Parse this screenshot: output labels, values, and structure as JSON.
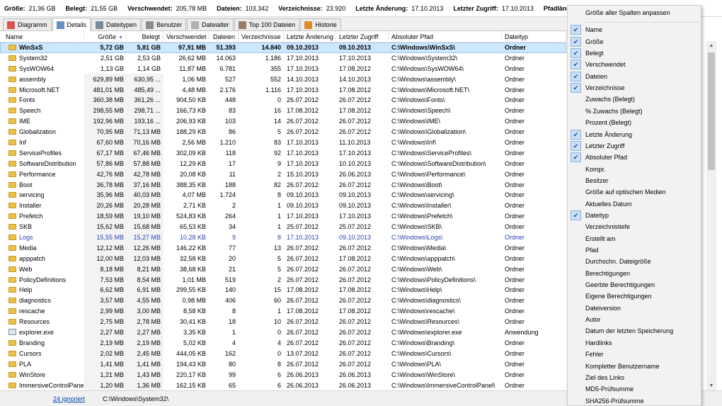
{
  "summary": [
    {
      "label": "Größe:",
      "value": "21,36 GB"
    },
    {
      "label": "Belegt:",
      "value": "21,55 GB"
    },
    {
      "label": "Verschwendet:",
      "value": "205,78 MB"
    },
    {
      "label": "Dateien:",
      "value": "103.342"
    },
    {
      "label": "Verzeichnisse:",
      "value": "23.920"
    },
    {
      "label": "Letzte Änderung:",
      "value": "17.10.2013"
    },
    {
      "label": "Letzter Zugriff:",
      "value": "17.10.2013"
    },
    {
      "label": "Pfadläng",
      "value": ""
    }
  ],
  "tabs": [
    {
      "label": "Diagramm",
      "icon": "chart-icon",
      "color": "#d9534f"
    },
    {
      "label": "Details",
      "icon": "details-icon",
      "color": "#6b8fbf",
      "active": true
    },
    {
      "label": "Dateitypen",
      "icon": "filetypes-icon",
      "color": "#7b8a9a"
    },
    {
      "label": "Benutzer",
      "icon": "users-icon",
      "color": "#8c8c8c"
    },
    {
      "label": "Dateialter",
      "icon": "fileage-icon",
      "color": "#b0b0b0"
    },
    {
      "label": "Top 100 Dateien",
      "icon": "top100-icon",
      "color": "#9a7b6a"
    },
    {
      "label": "Historie",
      "icon": "history-icon",
      "color": "#e08a2e"
    }
  ],
  "columns": [
    "Name",
    "Größe",
    "Belegt",
    "Verschwendet",
    "Dateien",
    "Verzeichnisse",
    "Letzte Änderung",
    "Letzter Zugriff",
    "Absoluter Pfad",
    "Dateityp"
  ],
  "rows": [
    [
      "WinSxS",
      "5,72 GB",
      "5,81 GB",
      "97,91 MB",
      "51.393",
      "14.840",
      "09.10.2013",
      "09.10.2013",
      "C:\\Windows\\WinSxS\\",
      "Ordner"
    ],
    [
      "System32",
      "2,51 GB",
      "2,53 GB",
      "26,62 MB",
      "14.063",
      "1.186",
      "17.10.2013",
      "17.10.2013",
      "C:\\Windows\\System32\\",
      "Ordner"
    ],
    [
      "SysWOW64",
      "1,13 GB",
      "1,14 GB",
      "11,87 MB",
      "6.781",
      "355",
      "17.10.2013",
      "17.08.2012",
      "C:\\Windows\\SysWOW64\\",
      "Ordner"
    ],
    [
      "assembly",
      "629,89 MB",
      "630,95 ...",
      "1,06 MB",
      "527",
      "552",
      "14.10.2013",
      "14.10.2013",
      "C:\\Windows\\assembly\\",
      "Ordner"
    ],
    [
      "Microsoft.NET",
      "481,01 MB",
      "485,49 ...",
      "4,48 MB",
      "2.176",
      "1.116",
      "17.10.2013",
      "17.08.2012",
      "C:\\Windows\\Microsoft.NET\\",
      "Ordner"
    ],
    [
      "Fonts",
      "360,38 MB",
      "361,26 ...",
      "904,50 KB",
      "448",
      "0",
      "26.07.2012",
      "26.07.2012",
      "C:\\Windows\\Fonts\\",
      "Ordner"
    ],
    [
      "Speech",
      "298,55 MB",
      "298,71 ...",
      "166,73 KB",
      "83",
      "16",
      "17.08.2012",
      "17.08.2012",
      "C:\\Windows\\Speech\\",
      "Ordner"
    ],
    [
      "IME",
      "192,96 MB",
      "193,16 ...",
      "206,93 KB",
      "103",
      "14",
      "26.07.2012",
      "26.07.2012",
      "C:\\Windows\\IME\\",
      "Ordner"
    ],
    [
      "Globalization",
      "70,95 MB",
      "71,13 MB",
      "188,29 KB",
      "86",
      "5",
      "26.07.2012",
      "26.07.2012",
      "C:\\Windows\\Globalization\\",
      "Ordner"
    ],
    [
      "Inf",
      "67,60 MB",
      "70,16 MB",
      "2,56 MB",
      "1.210",
      "83",
      "17.10.2013",
      "11.10.2013",
      "C:\\Windows\\Inf\\",
      "Ordner"
    ],
    [
      "ServiceProfiles",
      "67,17 MB",
      "67,46 MB",
      "302,09 KB",
      "118",
      "92",
      "17.10.2013",
      "17.10.2013",
      "C:\\Windows\\ServiceProfiles\\",
      "Ordner"
    ],
    [
      "SoftwareDistribution",
      "57,86 MB",
      "57,88 MB",
      "12,29 KB",
      "17",
      "9",
      "17.10.2013",
      "10.10.2013",
      "C:\\Windows\\SoftwareDistribution\\",
      "Ordner"
    ],
    [
      "Performance",
      "42,76 MB",
      "42,78 MB",
      "20,08 KB",
      "11",
      "2",
      "15.10.2013",
      "26.06.2013",
      "C:\\Windows\\Performance\\",
      "Ordner"
    ],
    [
      "Boot",
      "36,78 MB",
      "37,16 MB",
      "388,35 KB",
      "188",
      "82",
      "26.07.2012",
      "26.07.2012",
      "C:\\Windows\\Boot\\",
      "Ordner"
    ],
    [
      "servicing",
      "35,96 MB",
      "40,03 MB",
      "4,07 MB",
      "1.724",
      "8",
      "09.10.2013",
      "09.10.2013",
      "C:\\Windows\\servicing\\",
      "Ordner"
    ],
    [
      "Installer",
      "20,26 MB",
      "20,28 MB",
      "2,71 KB",
      "2",
      "1",
      "09.10.2013",
      "09.10.2013",
      "C:\\Windows\\Installer\\",
      "Ordner"
    ],
    [
      "Prefetch",
      "18,59 MB",
      "19,10 MB",
      "524,83 KB",
      "264",
      "1",
      "17.10.2013",
      "17.10.2013",
      "C:\\Windows\\Prefetch\\",
      "Ordner"
    ],
    [
      "SKB",
      "15,62 MB",
      "15,68 MB",
      "65,53 KB",
      "34",
      "1",
      "25.07.2012",
      "25.07.2012",
      "C:\\Windows\\SKB\\",
      "Ordner"
    ],
    [
      "Logs",
      "15,55 MB",
      "15,27 MB",
      "10,28 KB",
      "9",
      "8",
      "17.10.2013",
      "09.10.2013",
      "C:\\Windows\\Logs\\",
      "Ordner"
    ],
    [
      "Media",
      "12,12 MB",
      "12,26 MB",
      "146,22 KB",
      "77",
      "13",
      "26.07.2012",
      "26.07.2012",
      "C:\\Windows\\Media\\",
      "Ordner"
    ],
    [
      "apppatch",
      "12,00 MB",
      "12,03 MB",
      "32,58 KB",
      "20",
      "5",
      "26.07.2012",
      "17.08.2012",
      "C:\\Windows\\apppatch\\",
      "Ordner"
    ],
    [
      "Web",
      "8,18 MB",
      "8,21 MB",
      "38,68 KB",
      "21",
      "5",
      "26.07.2012",
      "26.07.2012",
      "C:\\Windows\\Web\\",
      "Ordner"
    ],
    [
      "PolicyDefinitions",
      "7,53 MB",
      "8,54 MB",
      "1,01 MB",
      "519",
      "2",
      "26.07.2012",
      "26.07.2012",
      "C:\\Windows\\PolicyDefinitions\\",
      "Ordner"
    ],
    [
      "Help",
      "6,62 MB",
      "6,91 MB",
      "299,55 KB",
      "140",
      "15",
      "17.08.2012",
      "17.08.2012",
      "C:\\Windows\\Help\\",
      "Ordner"
    ],
    [
      "diagnostics",
      "3,57 MB",
      "4,55 MB",
      "0,98 MB",
      "406",
      "60",
      "26.07.2012",
      "26.07.2012",
      "C:\\Windows\\diagnostics\\",
      "Ordner"
    ],
    [
      "rescache",
      "2,99 MB",
      "3,00 MB",
      "8,58 KB",
      "8",
      "1",
      "17.08.2012",
      "17.08.2012",
      "C:\\Windows\\rescache\\",
      "Ordner"
    ],
    [
      "Resources",
      "2,75 MB",
      "2,78 MB",
      "30,41 KB",
      "18",
      "10",
      "26.07.2012",
      "26.07.2012",
      "C:\\Windows\\Resources\\",
      "Ordner"
    ],
    [
      "explorer.exe",
      "2,27 MB",
      "2,27 MB",
      "3,35 KB",
      "1",
      "0",
      "26.07.2012",
      "26.07.2012",
      "C:\\Windows\\explorer.exe",
      "Anwendung"
    ],
    [
      "Branding",
      "2,19 MB",
      "2,19 MB",
      "5,02 KB",
      "4",
      "4",
      "26.07.2012",
      "26.07.2012",
      "C:\\Windows\\Branding\\",
      "Ordner"
    ],
    [
      "Cursors",
      "2,02 MB",
      "2,45 MB",
      "444,05 KB",
      "162",
      "0",
      "13.07.2012",
      "26.07.2012",
      "C:\\Windows\\Cursors\\",
      "Ordner"
    ],
    [
      "PLA",
      "1,41 MB",
      "1,41 MB",
      "194,43 KB",
      "80",
      "8",
      "26.07.2012",
      "26.07.2012",
      "C:\\Windows\\PLA\\",
      "Ordner"
    ],
    [
      "WinStore",
      "1,21 MB",
      "1,43 MB",
      "220,17 KB",
      "99",
      "6",
      "26.06.2013",
      "26.06.2013",
      "C:\\Windows\\WinStore\\",
      "Ordner"
    ],
    [
      "ImmersiveControlPanel",
      "1,20 MB",
      "1,36 MB",
      "162,15 KB",
      "65",
      "6",
      "26.06.2013",
      "26.06.2013",
      "C:\\Windows\\ImmersiveControlPanel\\",
      "Ordner"
    ]
  ],
  "row_types": [
    "folder",
    "folder",
    "folder",
    "folder",
    "folder",
    "folder",
    "folder",
    "folder",
    "folder",
    "folder",
    "folder",
    "folder",
    "folder",
    "folder",
    "folder",
    "folder",
    "folder",
    "folder",
    "folder",
    "folder",
    "folder",
    "folder",
    "folder",
    "folder",
    "folder",
    "folder",
    "folder",
    "file",
    "folder",
    "folder",
    "folder",
    "folder",
    "folder"
  ],
  "selected_row": 0,
  "highlight_row": 18,
  "status": {
    "ignored_link": "24 ignoriert",
    "path": "C:\\Windows\\System32\\"
  },
  "menu": {
    "items": [
      {
        "label": "Größe aller Spalten anpassen",
        "checked": false
      },
      {
        "label": "Name",
        "checked": true
      },
      {
        "label": "Größe",
        "checked": true
      },
      {
        "label": "Belegt",
        "checked": true
      },
      {
        "label": "Verschwendet",
        "checked": true
      },
      {
        "label": "Dateien",
        "checked": true
      },
      {
        "label": "Verzeichnisse",
        "checked": true
      },
      {
        "label": "Zuwachs (Belegt)",
        "checked": false
      },
      {
        "label": "% Zuwachs (Belegt)",
        "checked": false
      },
      {
        "label": "Prozent (Belegt)",
        "checked": false
      },
      {
        "label": "Letzte Änderung",
        "checked": true
      },
      {
        "label": "Letzter Zugriff",
        "checked": true
      },
      {
        "label": "Absoluter Pfad",
        "checked": true
      },
      {
        "label": "Kompr.",
        "checked": false
      },
      {
        "label": "Besitzer",
        "checked": false
      },
      {
        "label": "Größe auf optischen Medien",
        "checked": false
      },
      {
        "label": "Aktuelles Datum",
        "checked": false
      },
      {
        "label": "Dateityp",
        "checked": true
      },
      {
        "label": "Verzeichnistiefe",
        "checked": false
      },
      {
        "label": "Erstellt am",
        "checked": false
      },
      {
        "label": "Pfad",
        "checked": false
      },
      {
        "label": "Durchschn. Dateigröße",
        "checked": false
      },
      {
        "label": "Berechtigungen",
        "checked": false
      },
      {
        "label": "Geerbte Berechtigungen",
        "checked": false
      },
      {
        "label": "Eigene Berechtigungen",
        "checked": false
      },
      {
        "label": "Dateiversion",
        "checked": false
      },
      {
        "label": "Autor",
        "checked": false
      },
      {
        "label": "Datum der letzten Speicherung",
        "checked": false
      },
      {
        "label": "Hardlinks",
        "checked": false
      },
      {
        "label": "Fehler",
        "checked": false
      },
      {
        "label": "Kompletter Benutzername",
        "checked": false
      },
      {
        "label": "Ziel des Links",
        "checked": false
      },
      {
        "label": "MD5-Prüfsumme",
        "checked": false
      },
      {
        "label": "SHA256-Prüfsumme",
        "checked": false
      }
    ],
    "check_glyph": "✔"
  },
  "sort_indicator": "▼",
  "scroll": {
    "up": "▲",
    "down": "▼"
  },
  "colors": {
    "selection": "#cce8ff",
    "folder": "#e9c14c",
    "link": "#0645ad",
    "logs_text": "#2b3fae"
  }
}
